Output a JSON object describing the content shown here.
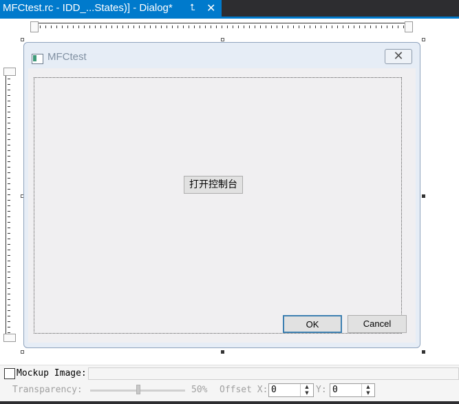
{
  "tab": {
    "title": "MFCtest.rc - IDD_...States)] - Dialog*",
    "pin_icon": "pin-icon",
    "close_icon": "close-icon"
  },
  "dialog": {
    "title": "MFCtest",
    "icon": "dialog-app-icon",
    "close_icon": "close-icon",
    "buttons": {
      "console": "打开控制台",
      "ok": "OK",
      "cancel": "Cancel"
    }
  },
  "mockup": {
    "label": "Mockup Image:",
    "transparency_label": "Transparency:",
    "transparency_value": "50%",
    "offset_x_label": "Offset X:",
    "offset_x_value": "0",
    "offset_y_label": "Y:",
    "offset_y_value": "0"
  },
  "colors": {
    "accent": "#007acc",
    "tabbar": "#2d2d30",
    "dialog_frame": "#e6edf6",
    "client": "#f0eff1"
  }
}
